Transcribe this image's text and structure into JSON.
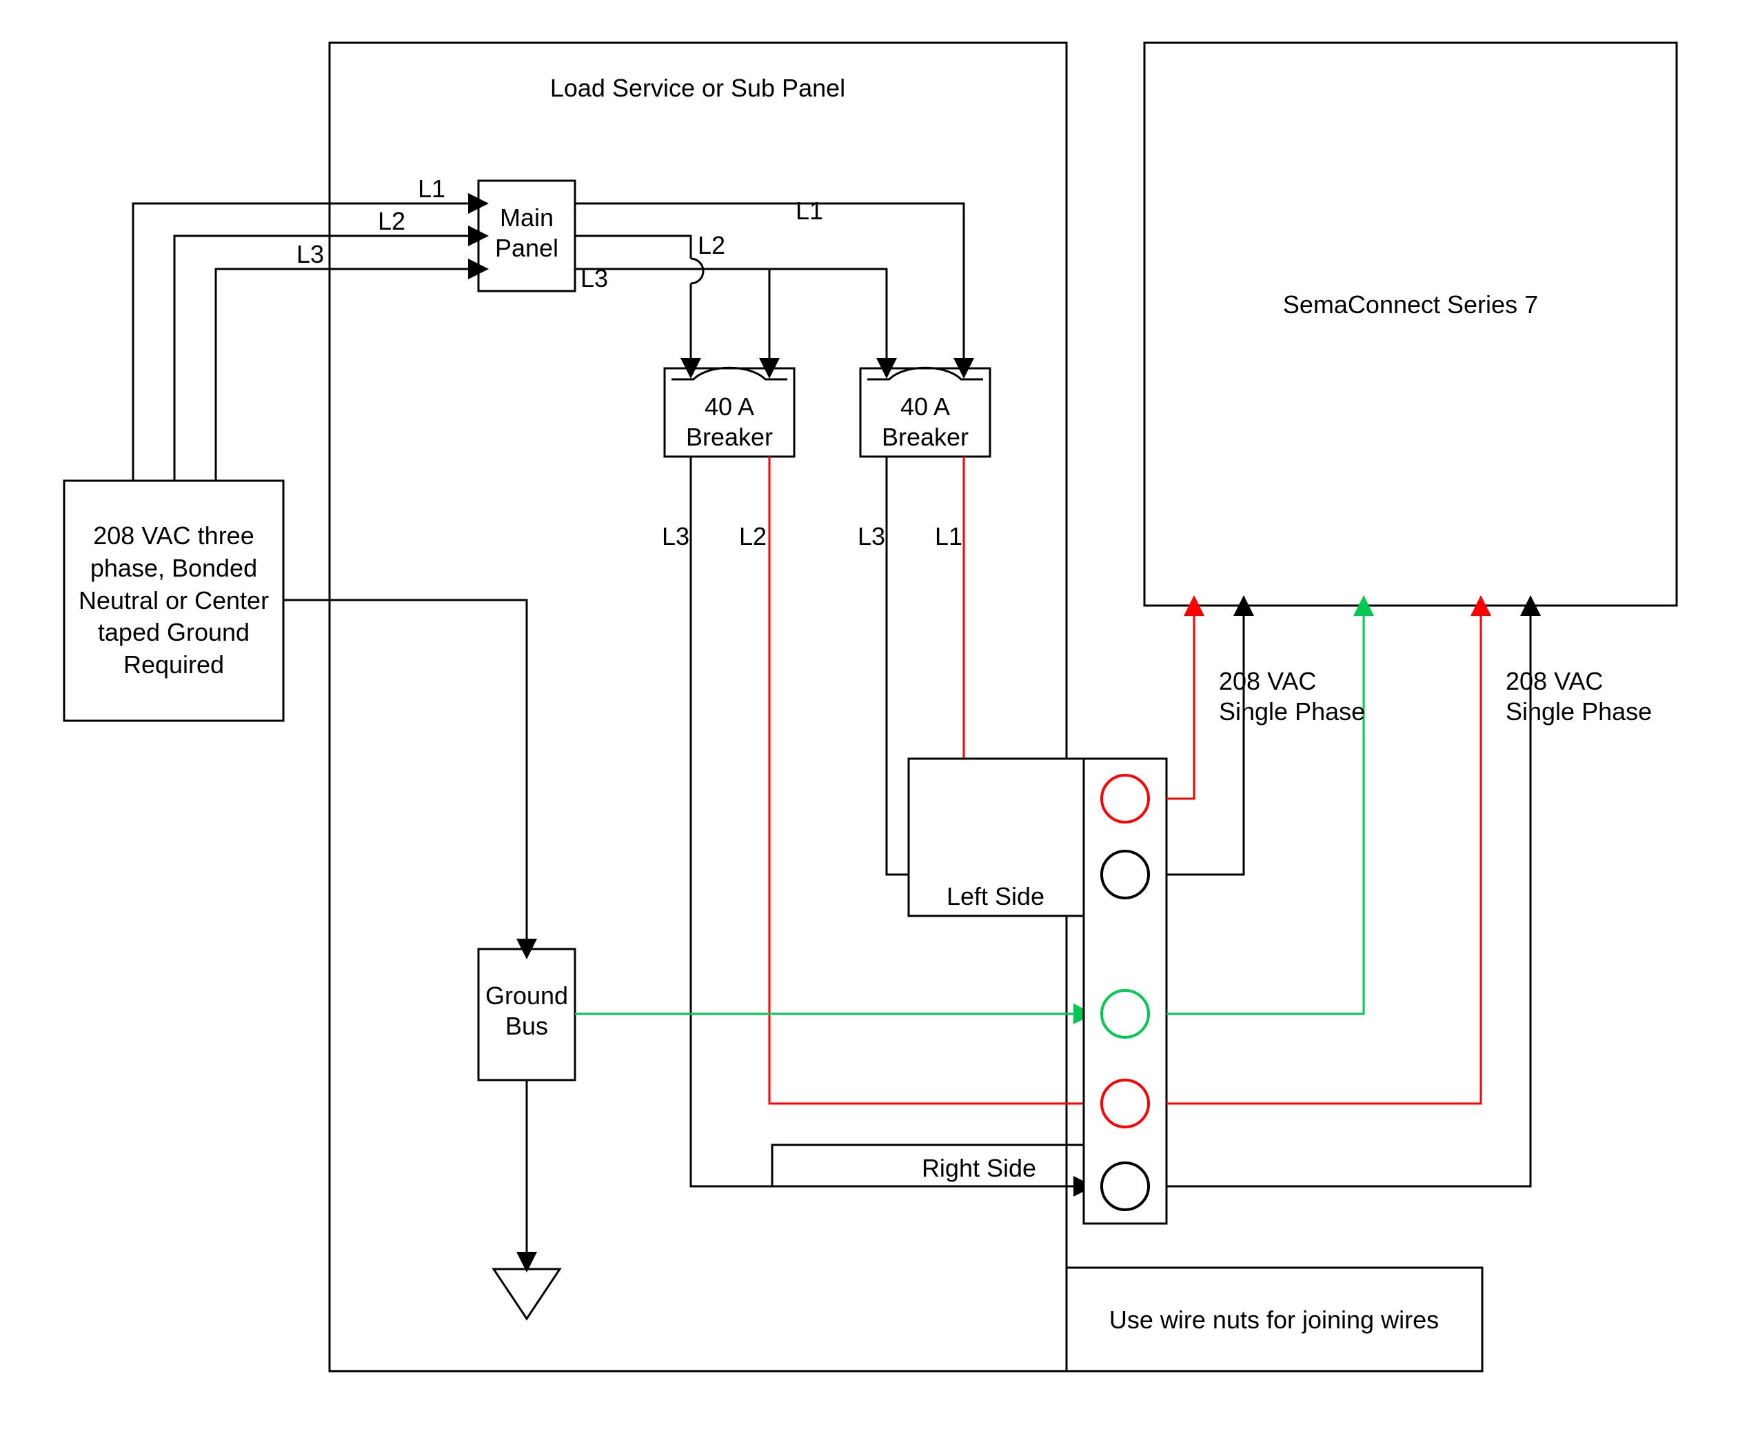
{
  "diagram": {
    "panel_title": "Load Service or Sub Panel",
    "source_box": "208 VAC three phase, Bonded Neutral or Center taped Ground Required",
    "main_panel": "Main Panel",
    "main_panel_l1": "Main",
    "main_panel_l2": "Panel",
    "breaker_label": "40 A Breaker",
    "breaker_amps": "40 A",
    "breaker_text": "Breaker",
    "ground_bus": "Ground Bus",
    "ground_bus_l1": "Ground",
    "ground_bus_l2": "Bus",
    "device_box": "SemaConnect Series 7",
    "phase_label": "208 VAC Single Phase",
    "phase_label_l1": "208 VAC",
    "phase_label_l2": "Single Phase",
    "left_side": "Left Side",
    "right_side": "Right Side",
    "wire_nuts_note": "Use wire nuts for joining wires",
    "lines": {
      "L1": "L1",
      "L2": "L2",
      "L3": "L3"
    },
    "colors": {
      "hot": "#ff0000",
      "neutral_ground": "#00c853",
      "default": "#000000"
    }
  }
}
